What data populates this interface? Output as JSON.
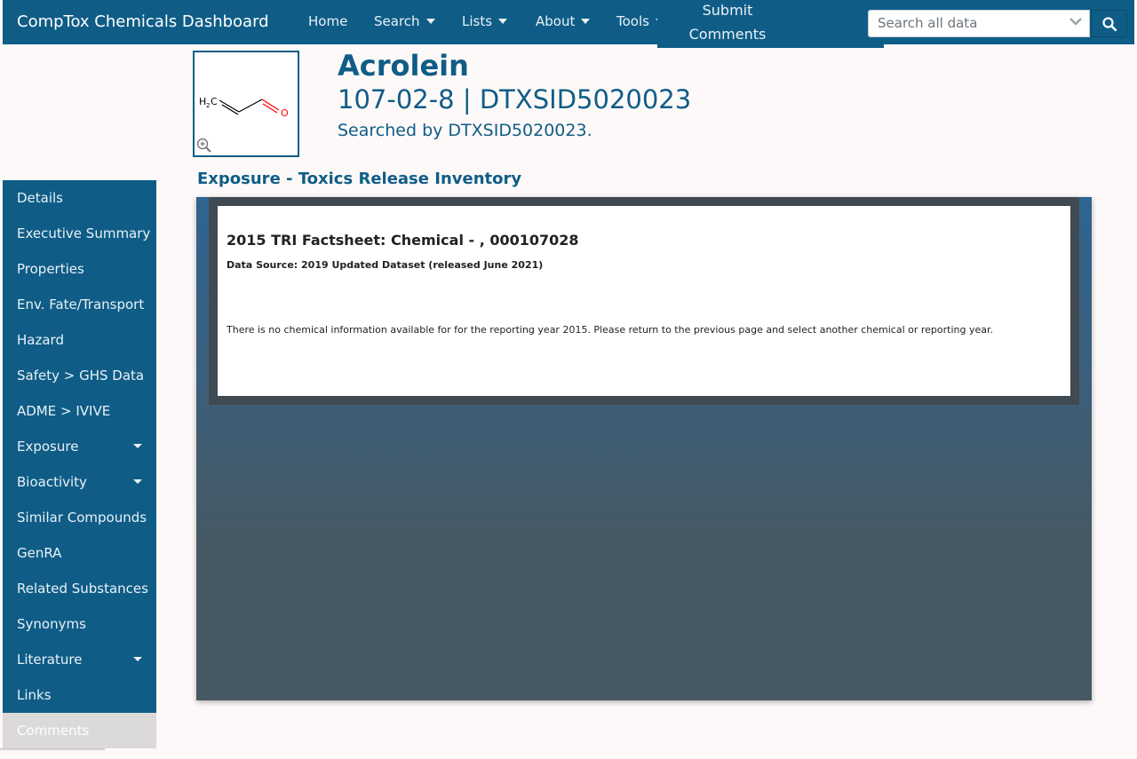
{
  "app": {
    "title": "CompTox Chemicals Dashboard"
  },
  "nav": {
    "home": "Home",
    "search": "Search",
    "lists": "Lists",
    "about": "About",
    "tools": "Tools",
    "submit_line1": "Submit",
    "submit_line2": "Comments"
  },
  "search": {
    "placeholder": "Search all data"
  },
  "chemical": {
    "name": "Acrolein",
    "ids": "107-02-8 | DTXSID5020023",
    "searched_by": "Searched by DTXSID5020023."
  },
  "sidebar": {
    "items": [
      {
        "label": "Details"
      },
      {
        "label": "Executive Summary"
      },
      {
        "label": "Properties"
      },
      {
        "label": "Env. Fate/Transport"
      },
      {
        "label": "Hazard"
      },
      {
        "label": "Safety > GHS Data"
      },
      {
        "label": "ADME > IVIVE"
      },
      {
        "label": "Exposure"
      },
      {
        "label": "Bioactivity"
      },
      {
        "label": "Similar Compounds"
      },
      {
        "label": "GenRA"
      },
      {
        "label": "Related Substances"
      },
      {
        "label": "Synonyms"
      },
      {
        "label": "Literature"
      },
      {
        "label": "Links"
      },
      {
        "label": "Comments"
      }
    ]
  },
  "section": {
    "title": "Exposure - Toxics Release Inventory"
  },
  "factsheet": {
    "title": "2015 TRI Factsheet: Chemical - , 000107028",
    "source": "Data Source: 2019 Updated Dataset (released June 2021)",
    "message": "There is no chemical information available for for the reporting year 2015. Please return to the previous page and select another chemical or reporting year."
  },
  "colors": {
    "brand": "#0f5d87",
    "background": "#fdf9f8"
  }
}
